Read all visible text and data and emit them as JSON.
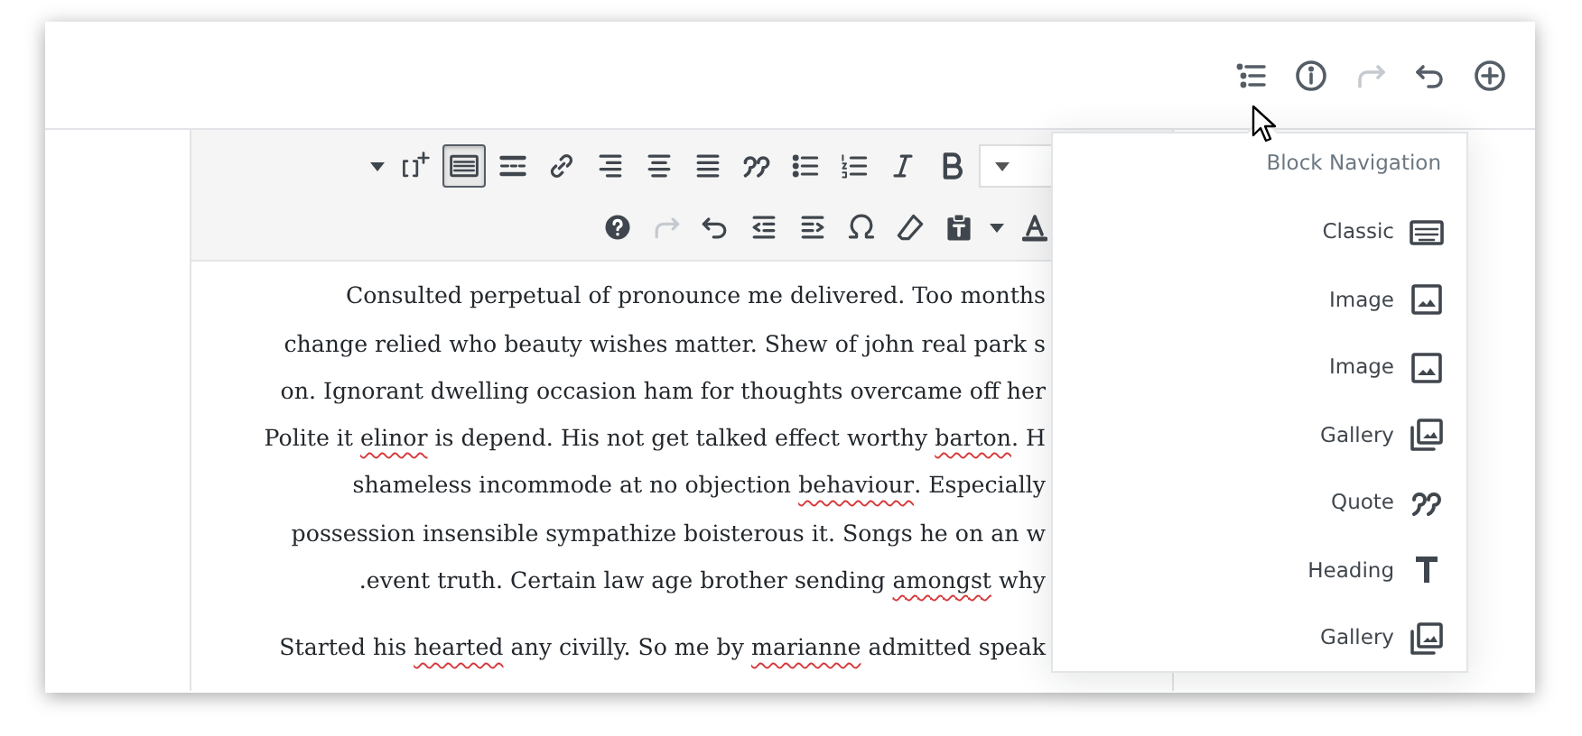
{
  "header_tools": [
    {
      "kind": "block-navigation",
      "disabled": false
    },
    {
      "kind": "info",
      "disabled": false
    },
    {
      "kind": "redo",
      "disabled": true
    },
    {
      "kind": "undo",
      "disabled": false
    },
    {
      "kind": "add",
      "disabled": false
    }
  ],
  "toolbar": {
    "row_1": [
      {
        "kind": "caret",
        "pressed": false,
        "disabled": false
      },
      {
        "kind": "shortcode",
        "pressed": false,
        "disabled": false
      },
      {
        "kind": "keyboard",
        "pressed": true,
        "disabled": false
      },
      {
        "kind": "more-tag",
        "pressed": false,
        "disabled": false
      },
      {
        "kind": "link",
        "pressed": false,
        "disabled": false
      },
      {
        "kind": "align-right",
        "pressed": false,
        "disabled": false
      },
      {
        "kind": "align-center",
        "pressed": false,
        "disabled": false
      },
      {
        "kind": "align-justify",
        "pressed": false,
        "disabled": false
      },
      {
        "kind": "quote",
        "pressed": false,
        "disabled": false
      },
      {
        "kind": "bullet-list",
        "pressed": false,
        "disabled": false
      },
      {
        "kind": "numbered-list",
        "pressed": false,
        "disabled": false
      },
      {
        "kind": "italic",
        "pressed": false,
        "disabled": false
      },
      {
        "kind": "bold",
        "pressed": false,
        "disabled": false
      },
      {
        "kind": "select"
      }
    ],
    "row_2": [
      {
        "kind": "help",
        "pressed": false,
        "disabled": false
      },
      {
        "kind": "redo",
        "pressed": false,
        "disabled": true
      },
      {
        "kind": "undo",
        "pressed": false,
        "disabled": false
      },
      {
        "kind": "outdent",
        "pressed": false,
        "disabled": false
      },
      {
        "kind": "indent",
        "pressed": false,
        "disabled": false
      },
      {
        "kind": "omega",
        "pressed": false,
        "disabled": false
      },
      {
        "kind": "eraser",
        "pressed": false,
        "disabled": false
      },
      {
        "kind": "paste-text",
        "pressed": false,
        "disabled": false
      },
      {
        "kind": "caret",
        "pressed": false,
        "disabled": false
      },
      {
        "kind": "text-color",
        "pressed": false,
        "disabled": false
      }
    ]
  },
  "paragraphs": [
    {
      "lines": [
        {
          "segments": [
            {
              "text": "Consulted perpetual of pronounce me delivered. Too months",
              "misspelled": false
            }
          ]
        },
        {
          "segments": [
            {
              "text": "change relied who beauty wishes matter. Shew of john real park s",
              "misspelled": false
            }
          ]
        },
        {
          "segments": [
            {
              "text": "on. Ignorant dwelling occasion ham for thoughts overcame off her",
              "misspelled": false
            }
          ]
        },
        {
          "segments": [
            {
              "text": "Polite it ",
              "misspelled": false
            },
            {
              "text": "elinor",
              "misspelled": true
            },
            {
              "text": " is depend. His not get talked effect worthy ",
              "misspelled": false
            },
            {
              "text": "barton",
              "misspelled": true
            },
            {
              "text": ". H",
              "misspelled": false
            }
          ]
        },
        {
          "segments": [
            {
              "text": "shameless incommode at no objection ",
              "misspelled": false
            },
            {
              "text": "behaviour",
              "misspelled": true
            },
            {
              "text": ". Especially",
              "misspelled": false
            }
          ]
        },
        {
          "segments": [
            {
              "text": "possession insensible sympathize boisterous it. Songs he on an w",
              "misspelled": false
            }
          ]
        },
        {
          "segments": [
            {
              "text": ".event truth. Certain law age brother sending ",
              "misspelled": false
            },
            {
              "text": "amongst",
              "misspelled": true
            },
            {
              "text": " why",
              "misspelled": false
            }
          ]
        }
      ]
    },
    {
      "lines": [
        {
          "segments": [
            {
              "text": "Started his ",
              "misspelled": false
            },
            {
              "text": "hearted",
              "misspelled": true
            },
            {
              "text": " any civilly. So me by ",
              "misspelled": false
            },
            {
              "text": "marianne",
              "misspelled": true
            },
            {
              "text": " admitted speak",
              "misspelled": false
            }
          ]
        }
      ]
    }
  ],
  "block_navigation": {
    "title": "Block Navigation",
    "items": [
      {
        "label": "Classic",
        "kind": "classic"
      },
      {
        "label": "Image",
        "kind": "image"
      },
      {
        "label": "Image",
        "kind": "image"
      },
      {
        "label": "Gallery",
        "kind": "gallery"
      },
      {
        "label": "Quote",
        "kind": "quote"
      },
      {
        "label": "Heading",
        "kind": "heading"
      },
      {
        "label": "Gallery",
        "kind": "gallery"
      }
    ]
  }
}
